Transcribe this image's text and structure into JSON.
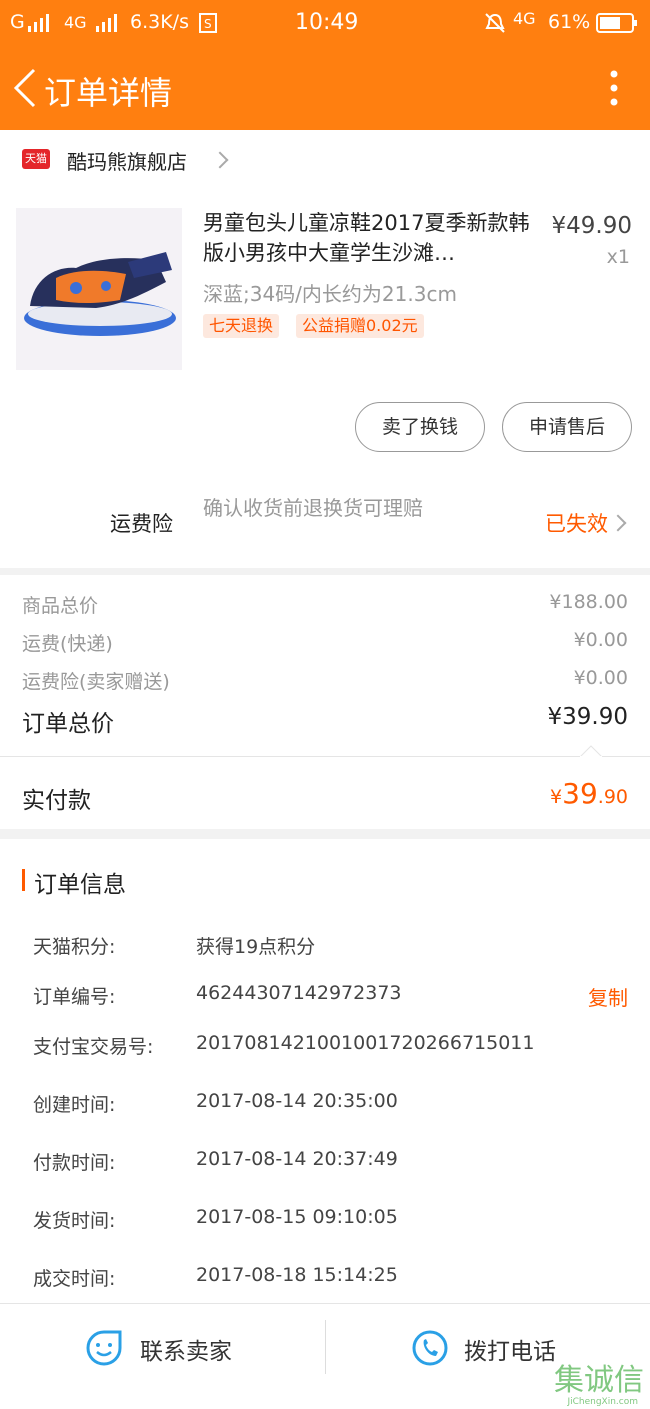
{
  "status_bar": {
    "signal_left": "G",
    "network": "4G",
    "speed": "6.3K/s",
    "time": "10:49",
    "network_right": "4G",
    "battery": "61%"
  },
  "nav": {
    "title": "订单详情",
    "back_icon": "back-chevron-icon",
    "more_icon": "more-vertical-icon"
  },
  "shop": {
    "badge": "天猫",
    "name": "酷玛熊旗舰店"
  },
  "product": {
    "title": "男童包头儿童凉鞋2017夏季新款韩版小男孩中大童学生沙滩…",
    "price": "¥49.90",
    "qty": "x1",
    "sku": "深蓝;34码/内长约为21.3cm",
    "tags": [
      "七天退换",
      "公益捐赠0.02元"
    ],
    "actions": [
      "卖了换钱",
      "申请售后"
    ]
  },
  "insurance": {
    "label": "运费险",
    "desc": "确认收货前退换货可理赔",
    "status": "已失效"
  },
  "totals": {
    "rows": [
      {
        "label": "商品总价",
        "value": "¥188.00"
      },
      {
        "label": "运费(快递)",
        "value": "¥0.00"
      },
      {
        "label": "运费险(卖家赠送)",
        "value": "¥0.00"
      }
    ],
    "order_total_label": "订单总价",
    "order_total_value": "¥39.90"
  },
  "paid": {
    "label": "实付款",
    "currency": "¥",
    "integer": "39",
    "decimal": ".90"
  },
  "order_info": {
    "title": "订单信息",
    "copy_label": "复制",
    "rows": [
      {
        "label": "天猫积分:",
        "value": "获得19点积分"
      },
      {
        "label": "订单编号:",
        "value": "46244307142972373"
      },
      {
        "label": "支付宝交易号:",
        "value": "2017081421001001720266715011"
      },
      {
        "label": "创建时间:",
        "value": "2017-08-14 20:35:00"
      },
      {
        "label": "付款时间:",
        "value": "2017-08-14 20:37:49"
      },
      {
        "label": "发货时间:",
        "value": "2017-08-15 09:10:05"
      },
      {
        "label": "成交时间:",
        "value": "2017-08-18 15:14:25"
      }
    ]
  },
  "footer": {
    "contact_seller": "联系卖家",
    "call_phone": "拨打电话"
  },
  "watermark": {
    "text": "集诚信",
    "sub": "JiChengXin.com"
  },
  "colors": {
    "brand": "#ff7f10",
    "accent": "#ff5a00",
    "icon_blue": "#2aa0e6"
  }
}
